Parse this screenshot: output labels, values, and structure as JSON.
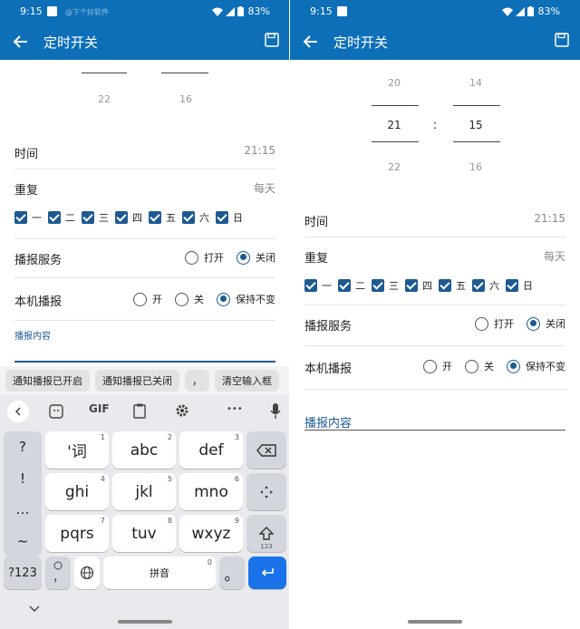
{
  "status": {
    "time": "9:15",
    "battery": "83%",
    "watermark": "@下个好软件"
  },
  "appbar": {
    "title": "定时开关"
  },
  "left": {
    "picker": {
      "hour_below": "22",
      "minute_below": "16"
    },
    "time_row": {
      "label": "时间",
      "value": "21:15"
    },
    "repeat_row": {
      "label": "重复",
      "value": "每天"
    },
    "days": [
      "一",
      "二",
      "三",
      "四",
      "五",
      "六",
      "日"
    ],
    "service_row": {
      "label": "播报服务",
      "opt_on": "打开",
      "opt_off": "关闭",
      "selected": "关闭"
    },
    "local_row": {
      "label": "本机播报",
      "opt_on": "开",
      "opt_off": "关",
      "opt_keep": "保持不变",
      "selected": "保持不变"
    },
    "content_label": "播报内容",
    "suggestions": [
      "通知播报已开启",
      "通知播报已关闭",
      "，",
      "清空输入框"
    ],
    "keyboard": {
      "toolbar": [
        "GIF",
        "•••"
      ],
      "side_keys": [
        "?",
        "!",
        "…",
        "~"
      ],
      "letters": [
        {
          "main": "'词",
          "hint": "1"
        },
        {
          "main": "abc",
          "hint": "2"
        },
        {
          "main": "def",
          "hint": "3"
        },
        {
          "main": "ghi",
          "hint": "4"
        },
        {
          "main": "jkl",
          "hint": "5"
        },
        {
          "main": "mno",
          "hint": "6"
        },
        {
          "main": "pqrs",
          "hint": "7"
        },
        {
          "main": "tuv",
          "hint": "8"
        },
        {
          "main": "wxyz",
          "hint": "9"
        }
      ],
      "mode_key": "?123",
      "emoji_comma": "，",
      "space_label": "拼音",
      "space_hint": "0",
      "period": "。",
      "shift_sub": "123"
    }
  },
  "right": {
    "picker": {
      "hour_above": "20",
      "hour": "21",
      "hour_below": "22",
      "minute_above": "14",
      "minute": "15",
      "minute_below": "16",
      "separator": ":"
    },
    "time_row": {
      "label": "时间",
      "value": "21:15"
    },
    "repeat_row": {
      "label": "重复",
      "value": "每天"
    },
    "days": [
      "一",
      "二",
      "三",
      "四",
      "五",
      "六",
      "日"
    ],
    "service_row": {
      "label": "播报服务",
      "opt_on": "打开",
      "opt_off": "关闭",
      "selected": "关闭"
    },
    "local_row": {
      "label": "本机播报",
      "opt_on": "开",
      "opt_off": "关",
      "opt_keep": "保持不变",
      "selected": "保持不变"
    },
    "content_label": "播报内容"
  },
  "colors": {
    "primary": "#0d6fb8",
    "checkbox": "#1d5a94",
    "enter_key": "#1a73e8"
  }
}
